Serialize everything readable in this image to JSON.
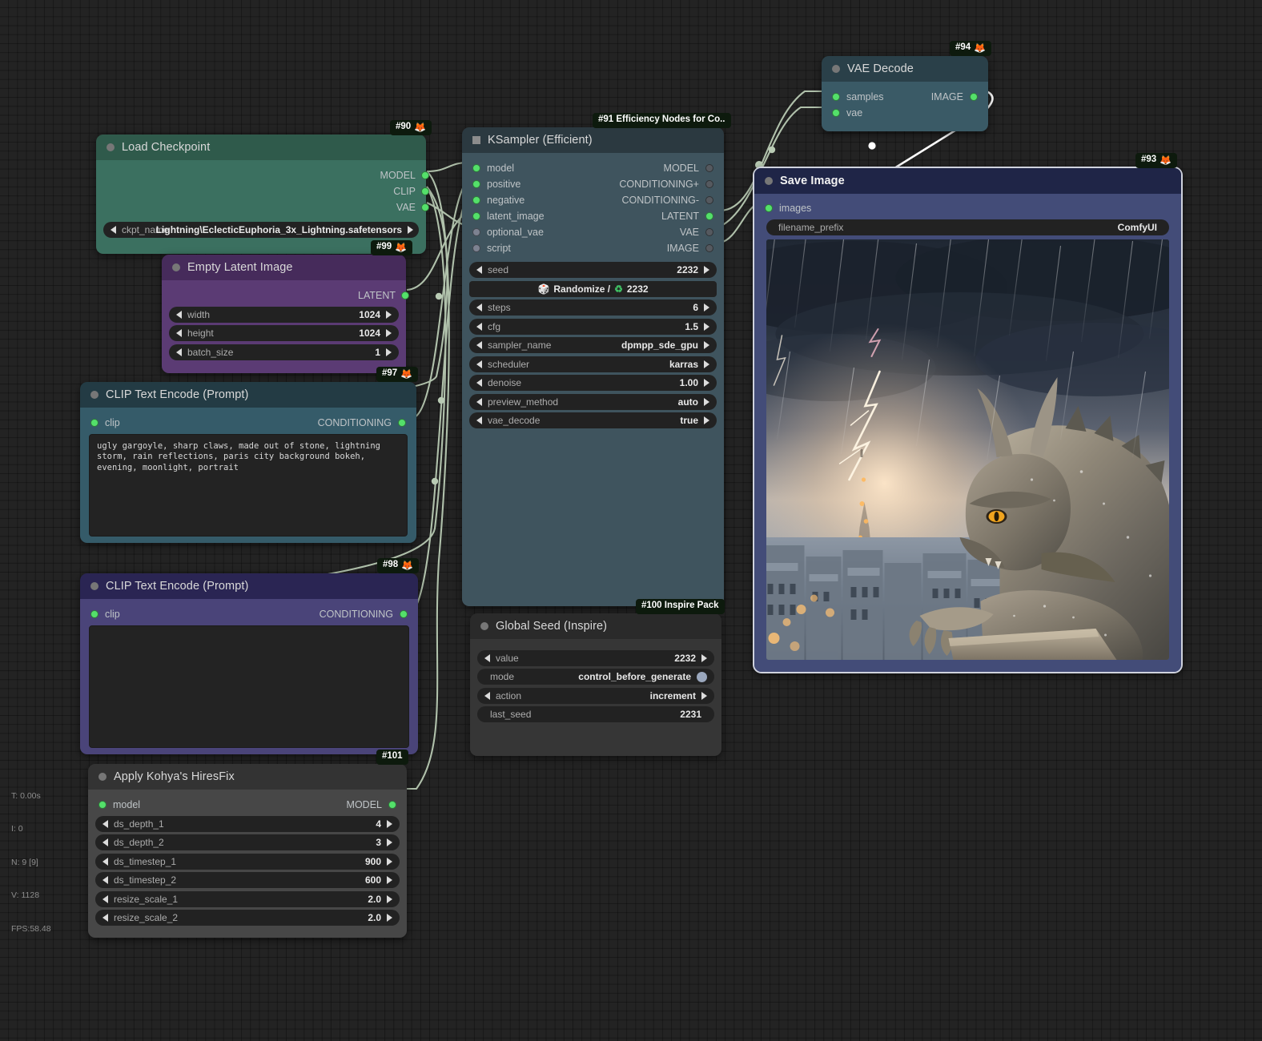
{
  "app": "ComfyUI node graph",
  "perf": {
    "time": "T: 0.00s",
    "iterations": "I: 0",
    "nodes": "N: 9 [9]",
    "vertices": "V: 1128",
    "fps": "FPS:58.48"
  },
  "colors": {
    "canvas_bg": "#232323",
    "wire": "#b9cbb4",
    "wire_image": "#ffffff",
    "port_connected": "#54e06a",
    "port_idle": "#7d8291",
    "badge_bg": "#0d1a0d",
    "checkpoint_node": "#3b7060",
    "latent_node": "#5b3b74",
    "positive_node": "#355b69",
    "negative_node": "#4a4479",
    "ksampler_node": "#3f545e",
    "hiresfix_node": "#474747",
    "seed_node": "#363636",
    "vae_node": "#3a5a66",
    "save_node": "#434c78"
  },
  "nodes": {
    "load_checkpoint": {
      "badge": "#90",
      "badge_icon": "fox-icon",
      "title": "Load Checkpoint",
      "outputs": [
        "MODEL",
        "CLIP",
        "VAE"
      ],
      "widgets": [
        {
          "name": "ckpt_name",
          "value": "Lightning\\EclecticEuphoria_3x_Lightning.safetensors"
        }
      ]
    },
    "empty_latent": {
      "badge": "#99",
      "badge_icon": "fox-icon",
      "title": "Empty Latent Image",
      "outputs": [
        "LATENT"
      ],
      "widgets": [
        {
          "name": "width",
          "value": "1024"
        },
        {
          "name": "height",
          "value": "1024"
        },
        {
          "name": "batch_size",
          "value": "1"
        }
      ]
    },
    "clip_positive": {
      "badge": "#97",
      "badge_icon": "fox-icon",
      "title": "CLIP Text Encode (Prompt)",
      "inputs": [
        "clip"
      ],
      "outputs": [
        "CONDITIONING"
      ],
      "text": "ugly gargoyle, sharp claws, made out of stone, lightning storm, rain reflections, paris city background bokeh, evening, moonlight, portrait"
    },
    "clip_negative": {
      "badge": "#98",
      "badge_icon": "fox-icon",
      "title": "CLIP Text Encode (Prompt)",
      "inputs": [
        "clip"
      ],
      "outputs": [
        "CONDITIONING"
      ],
      "text": ""
    },
    "ksampler": {
      "badge": "#91 Efficiency Nodes for Co..",
      "title": "KSampler (Efficient)",
      "inputs": [
        "model",
        "positive",
        "negative",
        "latent_image",
        "optional_vae",
        "script"
      ],
      "outputs": [
        "MODEL",
        "CONDITIONING+",
        "CONDITIONING-",
        "LATENT",
        "VAE",
        "IMAGE"
      ],
      "randomize_label": "Randomize /",
      "randomize_value": "2232",
      "widgets": [
        {
          "name": "seed",
          "value": "2232"
        },
        {
          "name": "steps",
          "value": "6"
        },
        {
          "name": "cfg",
          "value": "1.5"
        },
        {
          "name": "sampler_name",
          "value": "dpmpp_sde_gpu"
        },
        {
          "name": "scheduler",
          "value": "karras"
        },
        {
          "name": "denoise",
          "value": "1.00"
        },
        {
          "name": "preview_method",
          "value": "auto"
        },
        {
          "name": "vae_decode",
          "value": "true"
        }
      ]
    },
    "global_seed": {
      "badge": "#100 Inspire Pack",
      "title": "Global Seed (Inspire)",
      "widgets": [
        {
          "name": "value",
          "value": "2232",
          "kind": "stepper"
        },
        {
          "name": "mode",
          "value": "control_before_generate",
          "kind": "toggle"
        },
        {
          "name": "action",
          "value": "increment",
          "kind": "stepper"
        },
        {
          "name": "last_seed",
          "value": "2231",
          "kind": "readonly"
        }
      ]
    },
    "hiresfix": {
      "badge": "#101",
      "title": "Apply Kohya's HiresFix",
      "inputs": [
        "model"
      ],
      "outputs": [
        "MODEL"
      ],
      "widgets": [
        {
          "name": "ds_depth_1",
          "value": "4"
        },
        {
          "name": "ds_depth_2",
          "value": "3"
        },
        {
          "name": "ds_timestep_1",
          "value": "900"
        },
        {
          "name": "ds_timestep_2",
          "value": "600"
        },
        {
          "name": "resize_scale_1",
          "value": "2.0"
        },
        {
          "name": "resize_scale_2",
          "value": "2.0"
        }
      ]
    },
    "vae_decode": {
      "badge": "#94",
      "badge_icon": "fox-icon",
      "title": "VAE Decode",
      "inputs": [
        "samples",
        "vae"
      ],
      "outputs": [
        "IMAGE"
      ]
    },
    "save_image": {
      "badge": "#93",
      "badge_icon": "fox-icon",
      "title": "Save Image",
      "inputs": [
        "images"
      ],
      "widgets": [
        {
          "name": "filename_prefix",
          "value": "ComfyUI"
        }
      ],
      "preview_alt": "Stone gargoyle perched above Paris during a lightning storm at dusk"
    }
  }
}
